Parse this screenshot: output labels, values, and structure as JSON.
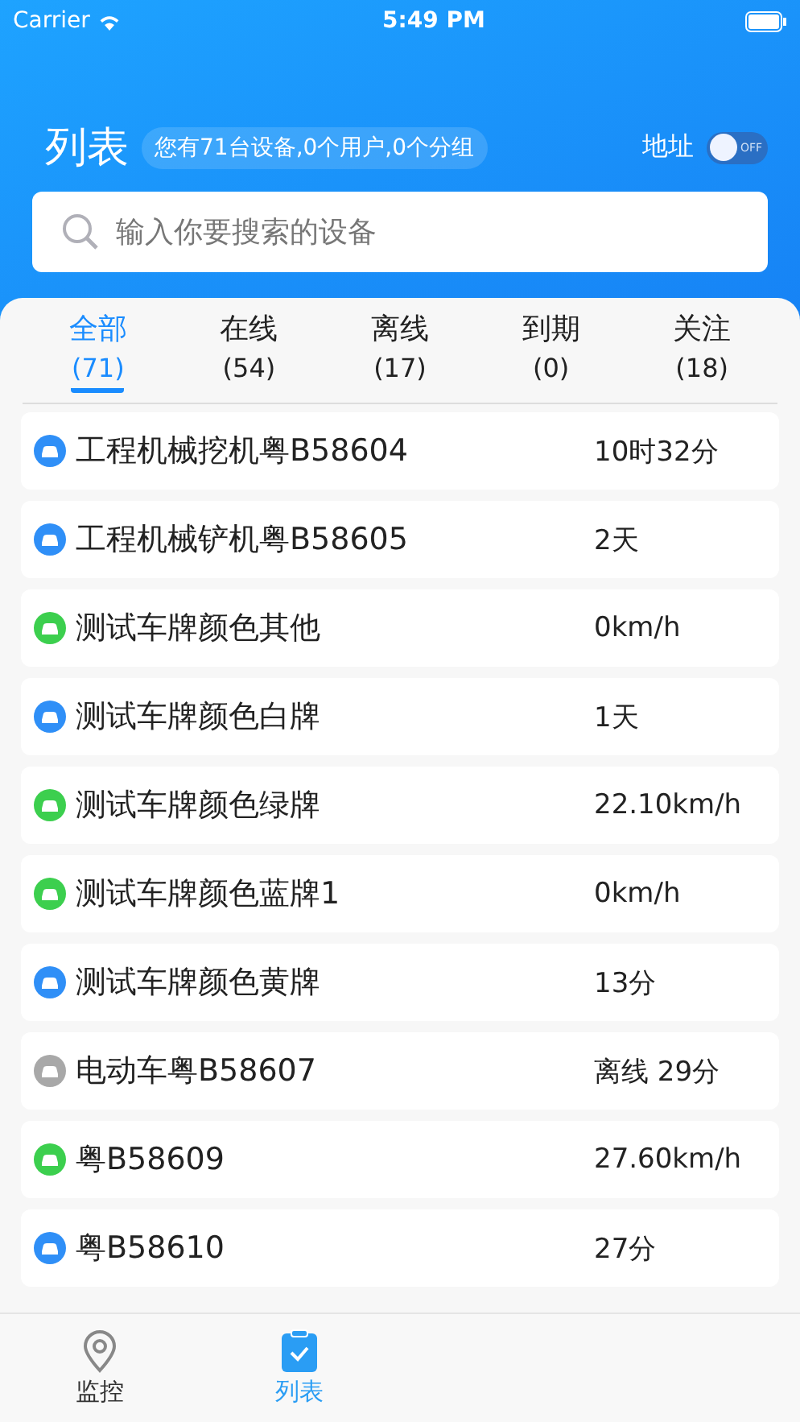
{
  "status_bar": {
    "carrier": "Carrier",
    "time": "5:49 PM"
  },
  "header": {
    "title": "列表",
    "summary": "您有71台设备,0个用户,0个分组",
    "address_label": "地址",
    "address_toggle": {
      "on": false,
      "label": "OFF"
    }
  },
  "search": {
    "placeholder": "输入你要搜索的设备"
  },
  "tabs": [
    {
      "label": "全部",
      "count": "(71)",
      "selected": true
    },
    {
      "label": "在线",
      "count": "(54)",
      "selected": false
    },
    {
      "label": "离线",
      "count": "(17)",
      "selected": false
    },
    {
      "label": "到期",
      "count": "(0)",
      "selected": false
    },
    {
      "label": "关注",
      "count": "(18)",
      "selected": false
    }
  ],
  "devices": [
    {
      "name": "工程机械挖机粤B58604",
      "status": "10时32分",
      "color": "#2f8ff7"
    },
    {
      "name": "工程机械铲机粤B58605",
      "status": "2天",
      "color": "#2f8ff7"
    },
    {
      "name": "测试车牌颜色其他",
      "status": "0km/h",
      "color": "#3ccf4e"
    },
    {
      "name": "测试车牌颜色白牌",
      "status": "1天",
      "color": "#2f8ff7"
    },
    {
      "name": "测试车牌颜色绿牌",
      "status": "22.10km/h",
      "color": "#3ccf4e"
    },
    {
      "name": "测试车牌颜色蓝牌1",
      "status": "0km/h",
      "color": "#3ccf4e"
    },
    {
      "name": "测试车牌颜色黄牌",
      "status": "13分",
      "color": "#2f8ff7"
    },
    {
      "name": "电动车粤B58607",
      "status": "离线 29分",
      "color": "#a8a8a8"
    },
    {
      "name": "粤B58609",
      "status": "27.60km/h",
      "color": "#3ccf4e"
    },
    {
      "name": "粤B58610",
      "status": "27分",
      "color": "#2f8ff7"
    }
  ],
  "bottom_nav": [
    {
      "label": "监控",
      "kind": "pin",
      "selected": false
    },
    {
      "label": "列表",
      "kind": "clipboard",
      "selected": true
    }
  ]
}
